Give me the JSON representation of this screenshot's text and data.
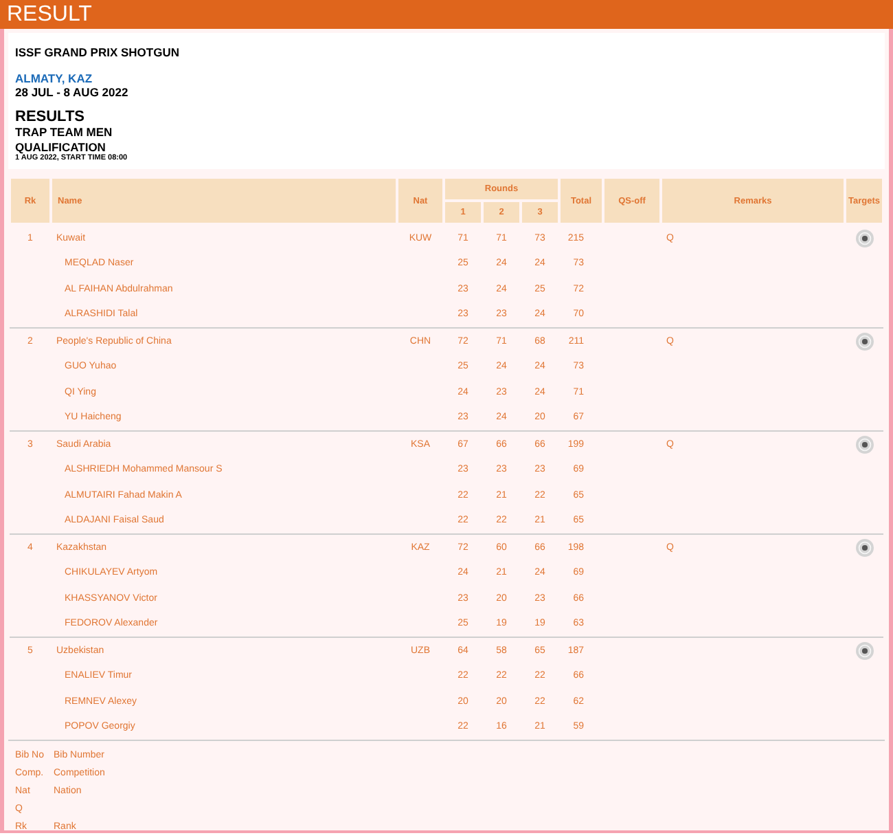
{
  "page_title": "RESULT",
  "info": {
    "event": "ISSF GRAND PRIX SHOTGUN",
    "location": "ALMATY, KAZ",
    "dates": "28 JUL - 8 AUG 2022",
    "heading": "RESULTS",
    "discipline": "TRAP TEAM MEN",
    "phase": "QUALIFICATION",
    "start": "1 AUG 2022, START TIME 08:00"
  },
  "table": {
    "columns": {
      "rank": "Rk",
      "name": "Name",
      "nat": "Nat",
      "rounds": "Rounds",
      "round_numbers": [
        "1",
        "2",
        "3"
      ],
      "total": "Total",
      "qs_off": "QS-off",
      "remarks": "Remarks",
      "targets": "Targets"
    },
    "teams": [
      {
        "rank": "1",
        "name": "Kuwait",
        "nat": "KUW",
        "rounds": [
          "71",
          "71",
          "73"
        ],
        "total": "215",
        "remarks": "Q",
        "athletes": [
          {
            "name": "MEQLAD Naser",
            "rounds": [
              "25",
              "24",
              "24"
            ],
            "total": "73"
          },
          {
            "name": "AL FAIHAN Abdulrahman",
            "rounds": [
              "23",
              "24",
              "25"
            ],
            "total": "72"
          },
          {
            "name": "ALRASHIDI Talal",
            "rounds": [
              "23",
              "23",
              "24"
            ],
            "total": "70"
          }
        ]
      },
      {
        "rank": "2",
        "name": "People's Republic of China",
        "nat": "CHN",
        "rounds": [
          "72",
          "71",
          "68"
        ],
        "total": "211",
        "remarks": "Q",
        "athletes": [
          {
            "name": "GUO Yuhao",
            "rounds": [
              "25",
              "24",
              "24"
            ],
            "total": "73"
          },
          {
            "name": "QI Ying",
            "rounds": [
              "24",
              "23",
              "24"
            ],
            "total": "71"
          },
          {
            "name": "YU Haicheng",
            "rounds": [
              "23",
              "24",
              "20"
            ],
            "total": "67"
          }
        ]
      },
      {
        "rank": "3",
        "name": "Saudi Arabia",
        "nat": "KSA",
        "rounds": [
          "67",
          "66",
          "66"
        ],
        "total": "199",
        "remarks": "Q",
        "athletes": [
          {
            "name": "ALSHRIEDH Mohammed Mansour S",
            "rounds": [
              "23",
              "23",
              "23"
            ],
            "total": "69"
          },
          {
            "name": "ALMUTAIRI Fahad Makin A",
            "rounds": [
              "22",
              "21",
              "22"
            ],
            "total": "65"
          },
          {
            "name": "ALDAJANI Faisal Saud",
            "rounds": [
              "22",
              "22",
              "21"
            ],
            "total": "65"
          }
        ]
      },
      {
        "rank": "4",
        "name": "Kazakhstan",
        "nat": "KAZ",
        "rounds": [
          "72",
          "60",
          "66"
        ],
        "total": "198",
        "remarks": "Q",
        "athletes": [
          {
            "name": "CHIKULAYEV Artyom",
            "rounds": [
              "24",
              "21",
              "24"
            ],
            "total": "69"
          },
          {
            "name": "KHASSYANOV Victor",
            "rounds": [
              "23",
              "20",
              "23"
            ],
            "total": "66"
          },
          {
            "name": "FEDOROV Alexander",
            "rounds": [
              "25",
              "19",
              "19"
            ],
            "total": "63"
          }
        ]
      },
      {
        "rank": "5",
        "name": "Uzbekistan",
        "nat": "UZB",
        "rounds": [
          "64",
          "58",
          "65"
        ],
        "total": "187",
        "athletes": [
          {
            "name": "ENALIEV Timur",
            "rounds": [
              "22",
              "22",
              "22"
            ],
            "total": "66"
          },
          {
            "name": "REMNEV Alexey",
            "rounds": [
              "20",
              "20",
              "22"
            ],
            "total": "62"
          },
          {
            "name": "POPOV Georgiy",
            "rounds": [
              "22",
              "16",
              "21"
            ],
            "total": "59"
          }
        ]
      }
    ]
  },
  "legend": [
    {
      "abbr": "Bib No",
      "meaning": "Bib Number"
    },
    {
      "abbr": "Comp.",
      "meaning": "Competition"
    },
    {
      "abbr": "Nat",
      "meaning": "Nation"
    },
    {
      "abbr": "Q"
    },
    {
      "abbr": "Rk",
      "meaning": "Rank"
    }
  ]
}
